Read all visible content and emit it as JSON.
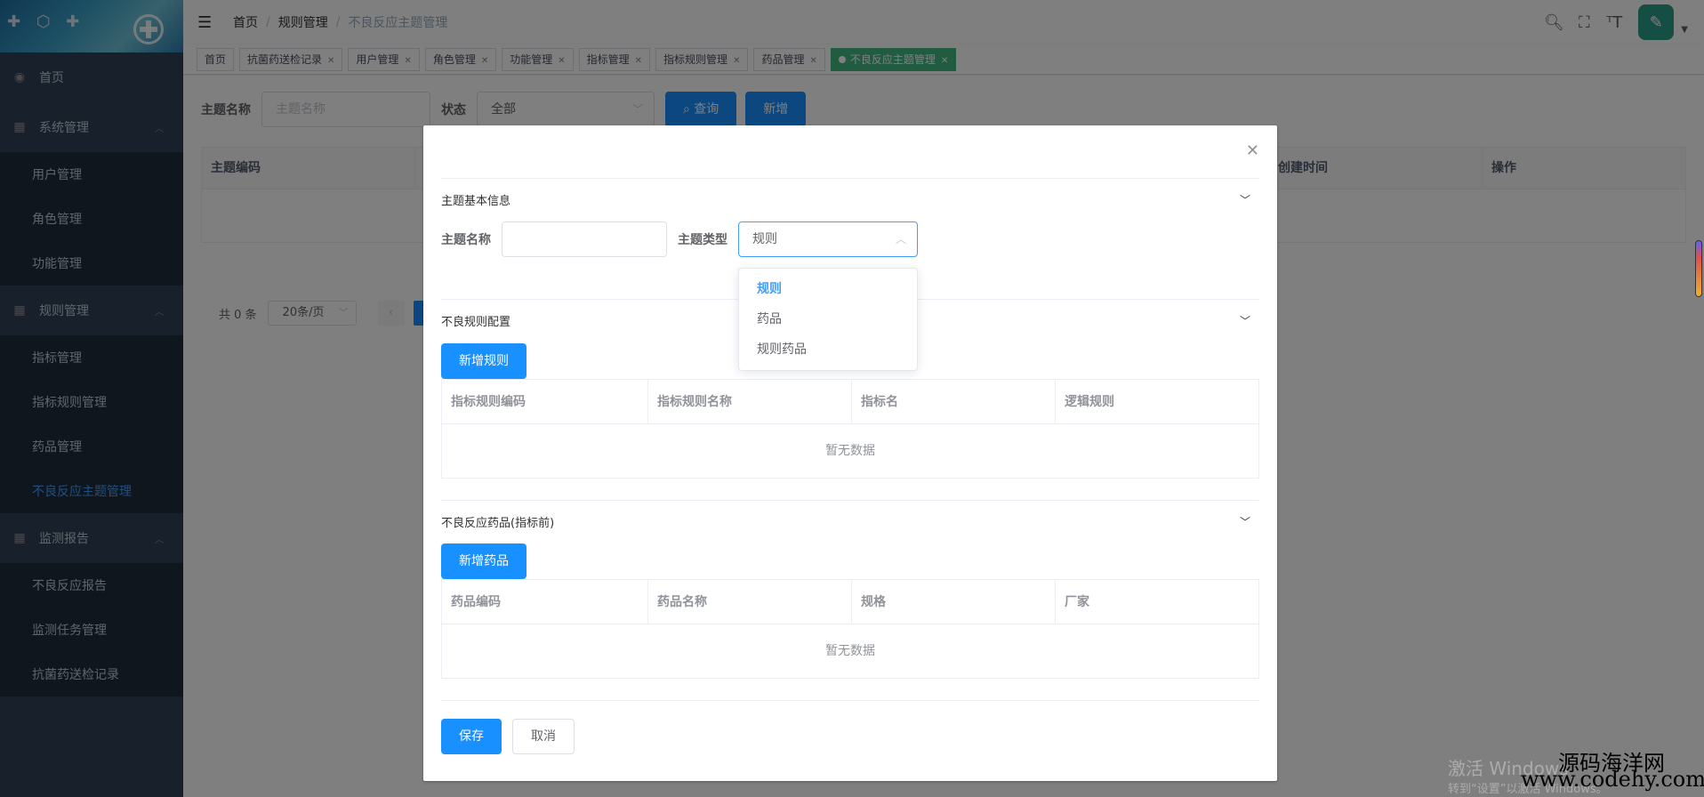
{
  "sidebar": {
    "items": [
      {
        "label": "首页",
        "icon": "dashboard-icon"
      },
      {
        "label": "系统管理",
        "icon": "grid-icon",
        "children": [
          "用户管理",
          "角色管理",
          "功能管理"
        ]
      },
      {
        "label": "规则管理",
        "icon": "grid-icon",
        "children": [
          "指标管理",
          "指标规则管理",
          "药品管理",
          "不良反应主题管理"
        ]
      },
      {
        "label": "监测报告",
        "icon": "grid-icon",
        "children": [
          "不良反应报告",
          "监测任务管理",
          "抗菌药送检记录"
        ]
      }
    ],
    "active": "不良反应主题管理"
  },
  "header": {
    "breadcrumb": [
      "首页",
      "规则管理",
      "不良反应主题管理"
    ]
  },
  "tags": [
    {
      "label": "首页",
      "closable": false
    },
    {
      "label": "抗菌药送检记录",
      "closable": true
    },
    {
      "label": "用户管理",
      "closable": true
    },
    {
      "label": "角色管理",
      "closable": true
    },
    {
      "label": "功能管理",
      "closable": true
    },
    {
      "label": "指标管理",
      "closable": true
    },
    {
      "label": "指标规则管理",
      "closable": true
    },
    {
      "label": "药品管理",
      "closable": true
    },
    {
      "label": "不良反应主题管理",
      "closable": true,
      "active": true
    }
  ],
  "search": {
    "name_label": "主题名称",
    "name_placeholder": "主题名称",
    "status_label": "状态",
    "status_value": "全部",
    "query_label": "查询",
    "add_label": "新增"
  },
  "bg_table": {
    "headers": [
      "主题编码",
      "创建时间",
      "操作"
    ]
  },
  "pagination": {
    "total_text": "共 0 条",
    "page_size": "20条/页"
  },
  "dialog": {
    "section_basic": "主题基本信息",
    "name_label": "主题名称",
    "type_label": "主题类型",
    "type_value": "规则",
    "type_options": [
      "规则",
      "药品",
      "规则药品"
    ],
    "section_rules": "不良规则配置",
    "add_rule_label": "新增规则",
    "rule_headers": [
      "指标规则编码",
      "指标规则名称",
      "指标名",
      "逻辑规则"
    ],
    "empty_text": "暂无数据",
    "section_drugs": "不良反应药品(指标前)",
    "add_drug_label": "新增药品",
    "drug_headers": [
      "药品编码",
      "药品名称",
      "规格",
      "厂家"
    ],
    "save_label": "保存",
    "cancel_label": "取消"
  },
  "watermark": {
    "windows_line1": "激活 Windows",
    "windows_line2": "转到“设置”以激活 Windows。",
    "site_name": "源码海洋网",
    "site_url": "www.codehy.com"
  }
}
